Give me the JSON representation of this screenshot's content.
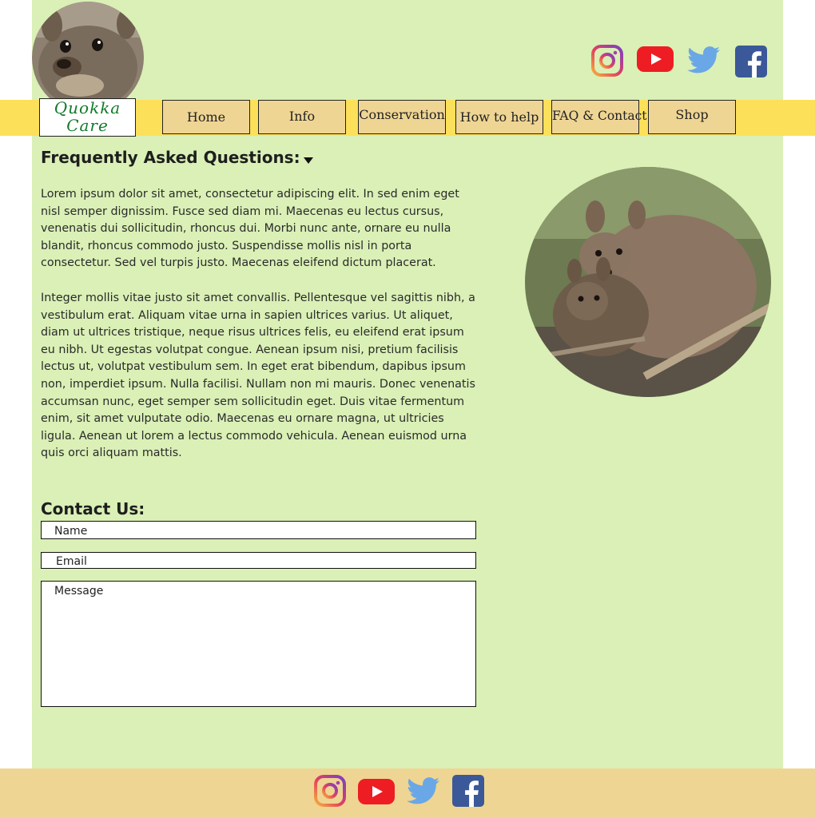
{
  "header": {
    "logo_line1": "Quokka",
    "logo_line2": "Care",
    "social": [
      {
        "icon": "instagram-icon"
      },
      {
        "icon": "youtube-icon"
      },
      {
        "icon": "twitter-icon"
      },
      {
        "icon": "facebook-icon"
      }
    ]
  },
  "nav": {
    "items": [
      "Home",
      "Info",
      "Conservation",
      "How to help",
      "FAQ & Contact",
      "Shop"
    ]
  },
  "faq": {
    "title": "Frequently Asked Questions:",
    "paragraph1": "Lorem ipsum dolor sit amet, consectetur adipiscing elit. In sed enim eget nisl semper dignissim. Fusce sed diam mi. Maecenas eu lectus cursus, venenatis dui sollicitudin, rhoncus dui. Morbi nunc ante, ornare eu nulla blandit, rhoncus commodo justo. Suspendisse mollis nisl in porta consectetur. Sed vel turpis justo. Maecenas eleifend dictum placerat.",
    "paragraph2": "Integer mollis vitae justo sit amet convallis. Pellentesque vel sagittis nibh, a vestibulum erat. Aliquam vitae urna in sapien ultrices varius. Ut aliquet, diam ut ultrices tristique, neque risus ultrices felis, eu eleifend erat ipsum eu nibh. Ut egestas volutpat congue. Aenean ipsum nisi, pretium facilisis lectus ut, volutpat vestibulum sem. In eget erat bibendum, dapibus ipsum non, imperdiet ipsum. Nulla facilisi. Nullam non mi mauris. Donec venenatis accumsan nunc, eget semper sem sollicitudin eget. Duis vitae fermentum enim, sit amet vulputate odio. Maecenas eu ornare magna, ut ultricies ligula. Aenean ut lorem a lectus commodo vehicula. Aenean euismod urna quis orci aliquam mattis."
  },
  "contact": {
    "title": "Contact Us:",
    "name_placeholder": "Name",
    "email_placeholder": "Email",
    "message_placeholder": "Message"
  },
  "colors": {
    "page_bg": "#daf0b6",
    "nav_band": "#fde05a",
    "nav_button": "#efd593",
    "footer_bg": "#efd593",
    "logo_text": "#117a2a"
  }
}
